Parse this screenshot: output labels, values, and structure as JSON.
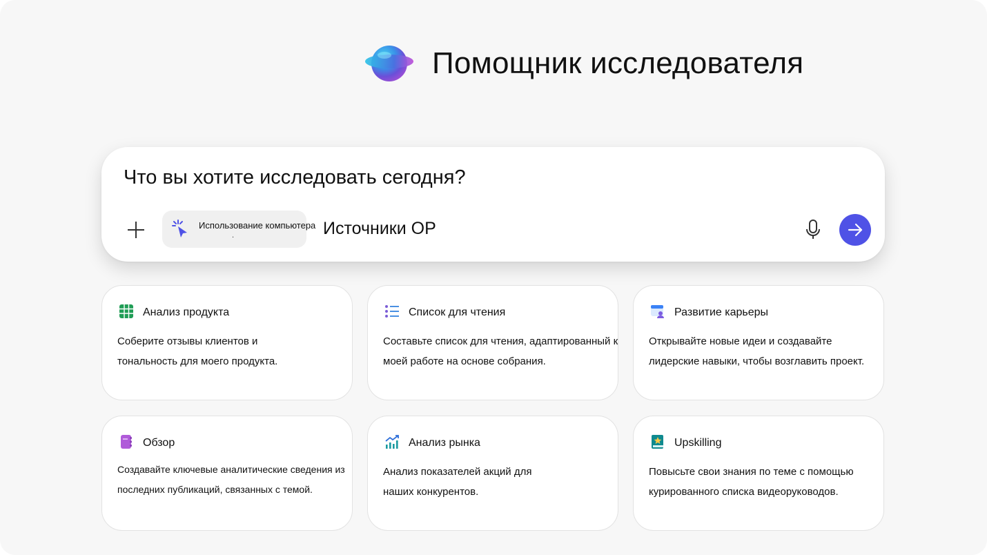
{
  "header": {
    "title": "Помощник исследователя",
    "logo_icon": "copilot-orb-icon"
  },
  "prompt": {
    "placeholder": "Что вы хотите исследовать сегодня?",
    "value": "",
    "add_icon": "plus-icon",
    "chip": {
      "label": "Использование компьютера",
      "sub": ".",
      "icon": "cursor-click-icon"
    },
    "sources_label": "Источники ОР",
    "mic_icon": "microphone-icon",
    "send_icon": "arrow-right-icon",
    "send_color": "#4f52e6"
  },
  "cards": [
    {
      "title": "Анализ продукта",
      "desc": "Соберите отзывы клиентов и\nтональность для моего продукта.",
      "icon": "spreadsheet-icon",
      "icon_color": "#1f9d55"
    },
    {
      "title": "Список для чтения",
      "desc": "Составьте список для чтения, адаптированный к\nмоей работе на основе собрания.",
      "icon": "list-icon",
      "icon_color": "#7a5cd6"
    },
    {
      "title": "Развитие карьеры",
      "desc": "Открывайте новые идеи и создавайте\nлидерские навыки, чтобы возглавить проект.",
      "icon": "calendar-people-icon",
      "icon_color": "#3b82f6"
    },
    {
      "title": "Обзор",
      "desc": "Создавайте ключевые аналитические сведения из\nпоследних публикаций, связанных с темой.",
      "icon": "notebook-icon",
      "icon_color": "#b05bd9"
    },
    {
      "title": "Анализ рынка",
      "desc": "Анализ показателей акций для\nнаших конкурентов.",
      "icon": "trend-chart-icon",
      "icon_color": "#1a9aa0"
    },
    {
      "title": "Upskilling",
      "desc": "Повысьте свои знания по теме с помощью\nкурированного списка видеоруководов.",
      "icon": "book-star-icon",
      "icon_color": "#0f8a8f"
    }
  ]
}
